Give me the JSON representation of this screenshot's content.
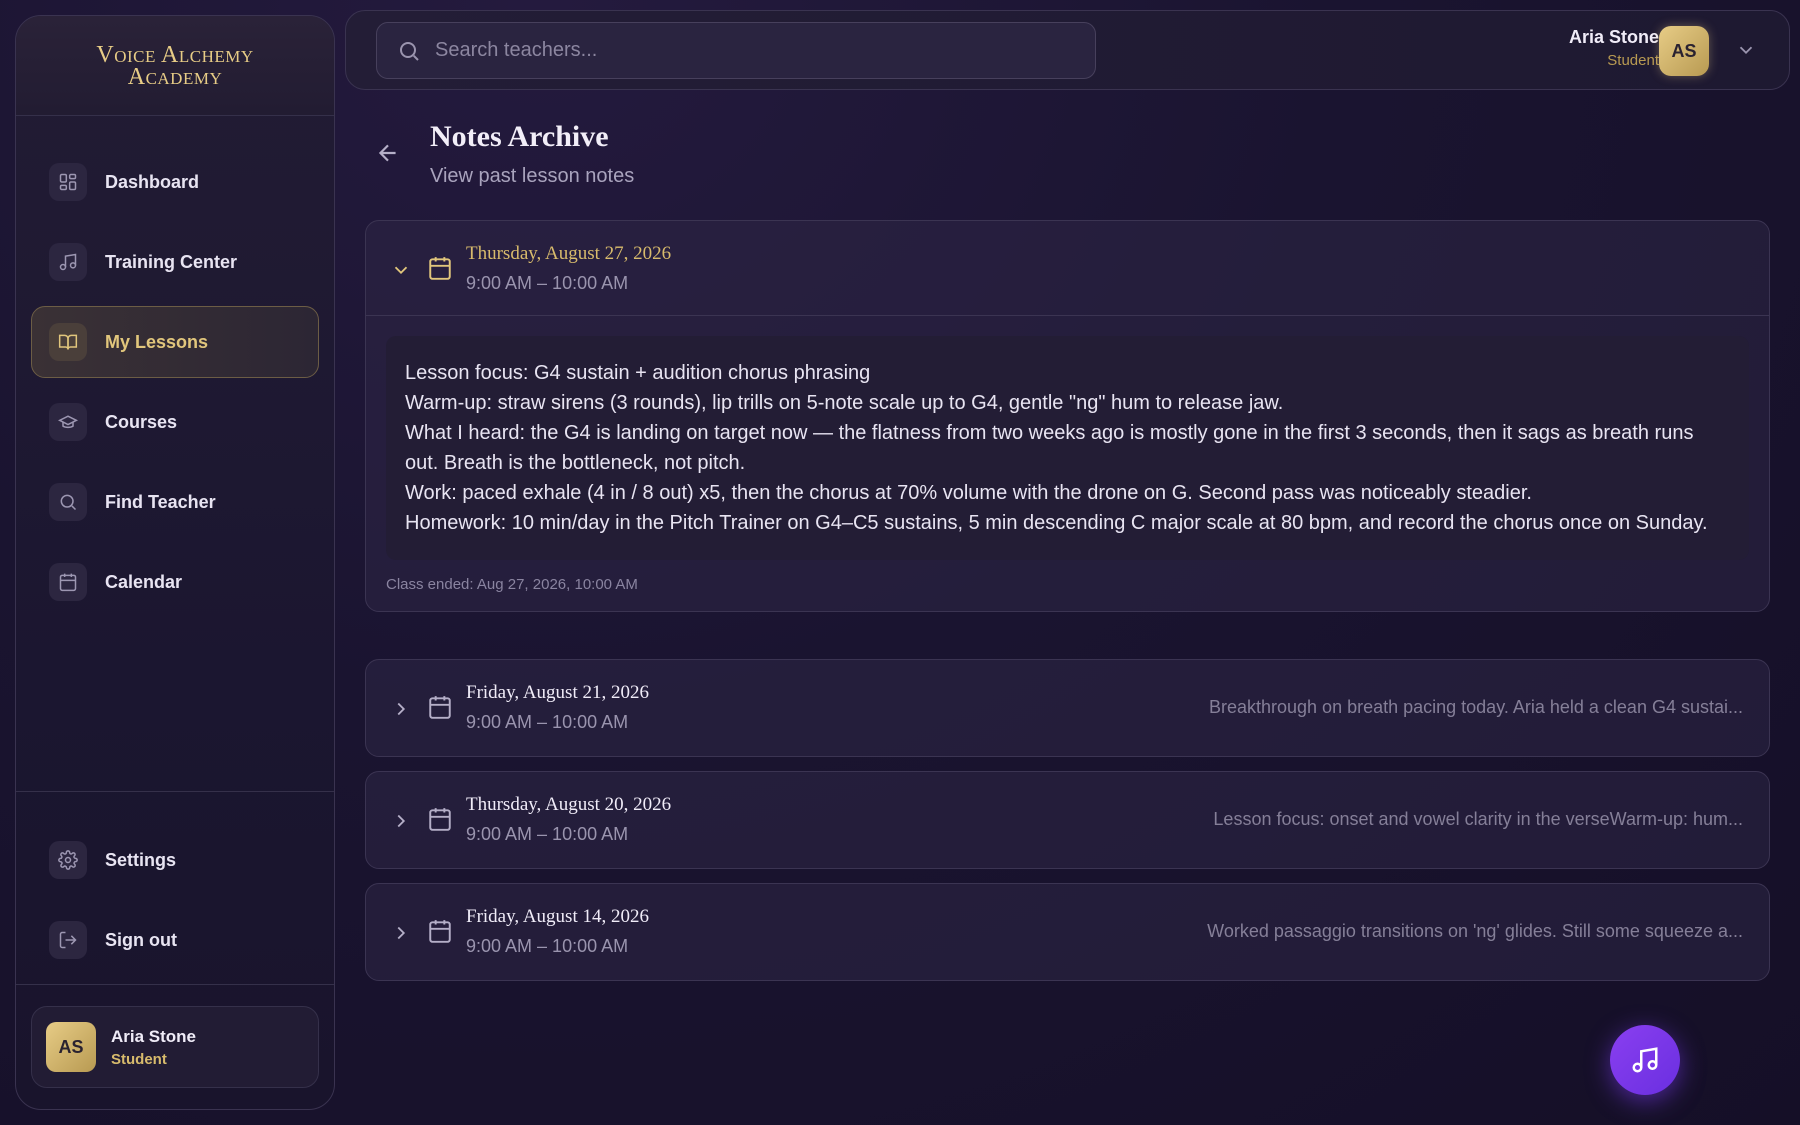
{
  "brand": {
    "line1": "Voice Alchemy",
    "line2": "Academy"
  },
  "sidebar": {
    "items": [
      {
        "label": "Dashboard",
        "icon": "grid-icon"
      },
      {
        "label": "Training Center",
        "icon": "music-note-icon"
      },
      {
        "label": "My Lessons",
        "icon": "book-icon",
        "active": true
      },
      {
        "label": "Courses",
        "icon": "graduation-cap-icon"
      },
      {
        "label": "Find Teacher",
        "icon": "search-icon"
      },
      {
        "label": "Calendar",
        "icon": "calendar-icon"
      }
    ],
    "bottom_items": [
      {
        "label": "Settings",
        "icon": "gear-icon"
      },
      {
        "label": "Sign out",
        "icon": "sign-out-icon"
      }
    ],
    "user": {
      "initials": "AS",
      "name": "Aria Stone",
      "role": "Student"
    }
  },
  "topbar": {
    "search_placeholder": "Search teachers...",
    "user": {
      "name": "Aria Stone",
      "role": "Student",
      "initials": "AS"
    }
  },
  "page": {
    "title": "Notes Archive",
    "subtitle": "View past lesson notes"
  },
  "notes": [
    {
      "date": "Thursday, August 27, 2026",
      "time": "9:00 AM – 10:00 AM",
      "expanded": true,
      "body": [
        "Lesson focus: G4 sustain + audition chorus phrasing",
        "Warm-up: straw sirens (3 rounds), lip trills on 5-note scale up to G4, gentle \"ng\" hum to release jaw.",
        "What I heard: the G4 is landing on target now — the flatness from two weeks ago is mostly gone in the first 3 seconds, then it sags as breath runs out. Breath is the bottleneck, not pitch.",
        "Work: paced exhale (4 in / 8 out) x5, then the chorus at 70% volume with the drone on G. Second pass was noticeably steadier.",
        "Homework: 10 min/day in the Pitch Trainer on G4–C5 sustains, 5 min descending C major scale at 80 bpm, and record the chorus once on Sunday."
      ],
      "ended": "Class ended: Aug 27, 2026, 10:00 AM"
    },
    {
      "date": "Friday, August 21, 2026",
      "time": "9:00 AM – 10:00 AM",
      "preview": "Breakthrough on breath pacing today. Aria held a clean G4 sustai..."
    },
    {
      "date": "Thursday, August 20, 2026",
      "time": "9:00 AM – 10:00 AM",
      "preview": "Lesson focus: onset and vowel clarity in the verseWarm-up: hum..."
    },
    {
      "date": "Friday, August 14, 2026",
      "time": "9:00 AM – 10:00 AM",
      "preview": "Worked passaggio transitions on 'ng' glides. Still some squeeze a..."
    }
  ],
  "colors": {
    "accent_gold": "#e1c67c",
    "fab_purple": "#7a3af0",
    "background": "#1a1430"
  }
}
